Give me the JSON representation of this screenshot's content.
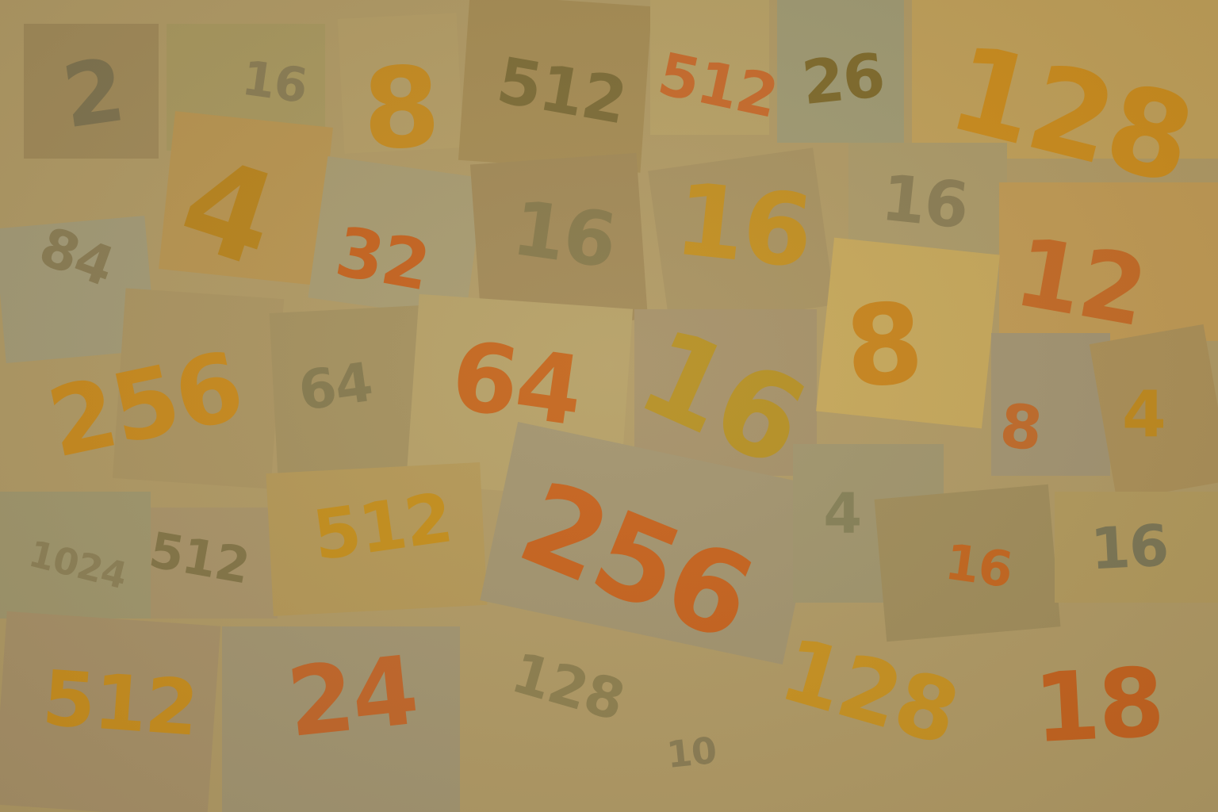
{
  "tiles": [
    {
      "color": "#a08a5a"
    },
    {
      "color": "#a89860"
    },
    {
      "color": "#b39d67"
    },
    {
      "color": "#a58c55"
    },
    {
      "color": "#b7a167"
    },
    {
      "color": "#9f9a74"
    },
    {
      "color": "#c0a05a"
    },
    {
      "color": "#b89552"
    },
    {
      "color": "#a79b72"
    },
    {
      "color": "#a18958"
    },
    {
      "color": "#a79262"
    },
    {
      "color": "#ab9a6a"
    },
    {
      "color": "#c09a55"
    },
    {
      "color": "#a39b78"
    },
    {
      "color": "#ab9563"
    },
    {
      "color": "#a49160"
    },
    {
      "color": "#b5a068"
    },
    {
      "color": "#a5916a"
    },
    {
      "color": "#c6a85c"
    },
    {
      "color": "#a29473"
    },
    {
      "color": "#ab9059"
    },
    {
      "color": "#a0976e"
    },
    {
      "color": "#a9946a"
    },
    {
      "color": "#b49858"
    },
    {
      "color": "#a29470"
    },
    {
      "color": "#a0956e"
    },
    {
      "color": "#a08d5c"
    },
    {
      "color": "#b29a5e"
    },
    {
      "color": "#a79169"
    },
    {
      "color": "#a29572"
    }
  ],
  "numbers": [
    {
      "text": "2",
      "color": "#7e7350"
    },
    {
      "text": "16",
      "color": "#8a7d55"
    },
    {
      "text": "8",
      "color": "#c58b21"
    },
    {
      "text": "512",
      "color": "#7c6c38"
    },
    {
      "text": "512",
      "color": "#c76a2c"
    },
    {
      "text": "26",
      "color": "#7e6a2c"
    },
    {
      "text": "128",
      "color": "#cb8c1d"
    },
    {
      "text": "4",
      "color": "#b8841e"
    },
    {
      "text": "84",
      "color": "#8a7d55"
    },
    {
      "text": "32",
      "color": "#c4621f"
    },
    {
      "text": "16",
      "color": "#86794c"
    },
    {
      "text": "16",
      "color": "#c28f22"
    },
    {
      "text": "16",
      "color": "#8a7d55"
    },
    {
      "text": "12",
      "color": "#c46a26"
    },
    {
      "text": "256",
      "color": "#c88a1e"
    },
    {
      "text": "64",
      "color": "#857a50"
    },
    {
      "text": "64",
      "color": "#c4661f"
    },
    {
      "text": "16",
      "color": "#b59025"
    },
    {
      "text": "8",
      "color": "#c7841e"
    },
    {
      "text": "8",
      "color": "#c06a2a"
    },
    {
      "text": "4",
      "color": "#c08a1e"
    },
    {
      "text": "1024",
      "color": "#8d8158"
    },
    {
      "text": "512",
      "color": "#837548"
    },
    {
      "text": "512",
      "color": "#c48e1c"
    },
    {
      "text": "256",
      "color": "#c6621e"
    },
    {
      "text": "4",
      "color": "#858058"
    },
    {
      "text": "16",
      "color": "#c4661f"
    },
    {
      "text": "16",
      "color": "#7b7656"
    },
    {
      "text": "512",
      "color": "#c88e1e"
    },
    {
      "text": "24",
      "color": "#c2662a"
    },
    {
      "text": "128",
      "color": "#8d7f50"
    },
    {
      "text": "10",
      "color": "#8a7d55"
    },
    {
      "text": "128",
      "color": "#c89221"
    },
    {
      "text": "18",
      "color": "#c4621f"
    }
  ]
}
